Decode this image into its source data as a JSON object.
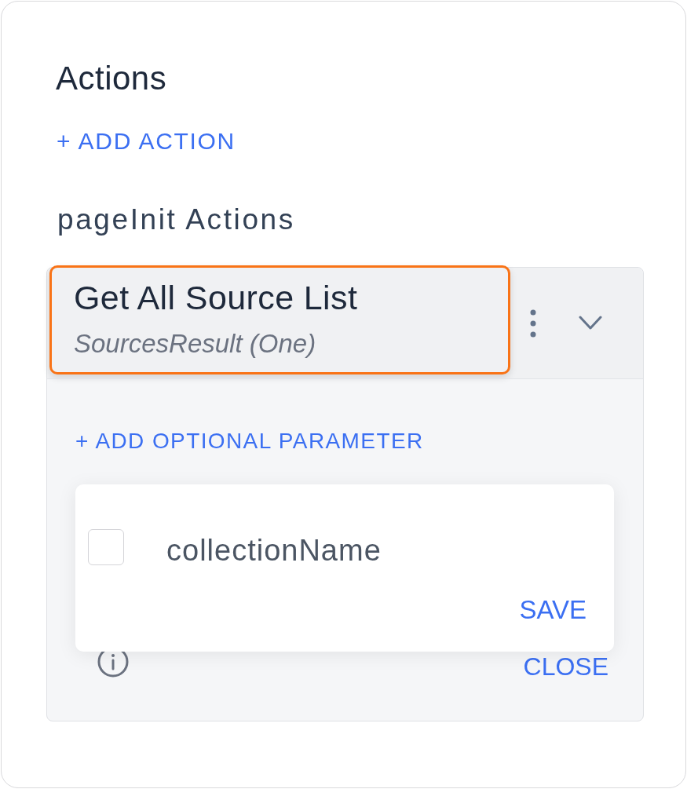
{
  "section": {
    "title": "Actions",
    "add_button": "+ ADD ACTION"
  },
  "group": {
    "title": "pageInit Actions",
    "actions": [
      {
        "name": "Get All Source List",
        "subtitle": "SourcesResult (One)",
        "selected": true,
        "expanded": true,
        "add_parameter": "+ ADD OPTIONAL PARAMETER",
        "close_button": "CLOSE",
        "parameter_popup": {
          "parameters": [
            {
              "name": "collectionName",
              "checked": false
            }
          ],
          "save_button": "SAVE"
        }
      }
    ]
  }
}
